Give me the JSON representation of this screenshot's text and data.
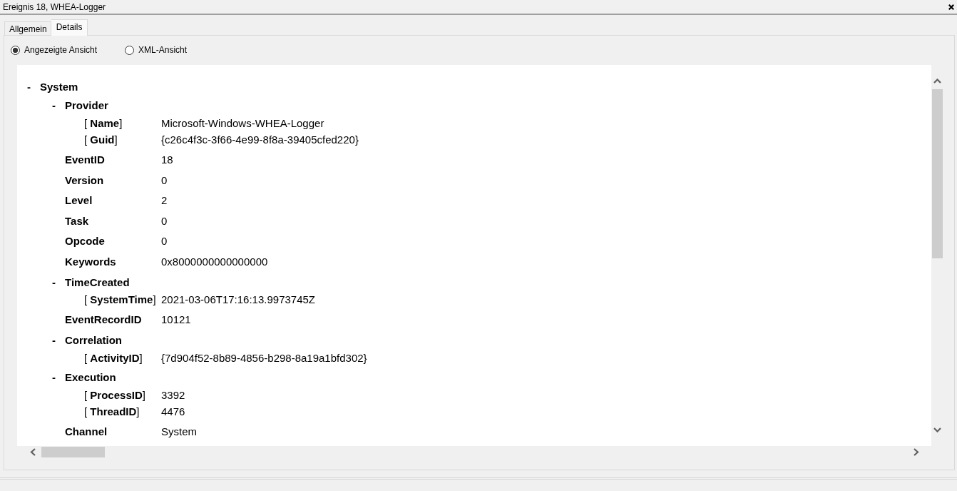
{
  "window": {
    "title": "Ereignis 18, WHEA-Logger"
  },
  "tabs": [
    {
      "label": "Allgemein",
      "selected": false
    },
    {
      "label": "Details",
      "selected": true
    }
  ],
  "view_options": [
    {
      "label": "Angezeigte Ansicht",
      "selected": true
    },
    {
      "label": "XML-Ansicht",
      "selected": false
    }
  ],
  "event_tree": [
    {
      "toggle": "-",
      "name": "System",
      "children": [
        {
          "toggle": "-",
          "name": "Provider",
          "attributes": [
            {
              "label": "[ **Name**]",
              "value": "Microsoft-Windows-WHEA-Logger"
            },
            {
              "label": "[ **Guid**]",
              "value": "{c26c4f3c-3f66-4e99-8f8a-39405cfed220}"
            }
          ]
        },
        {
          "name": "EventID",
          "value": "18"
        },
        {
          "name": "Version",
          "value": "0"
        },
        {
          "name": "Level",
          "value": "2"
        },
        {
          "name": "Task",
          "value": "0"
        },
        {
          "name": "Opcode",
          "value": "0"
        },
        {
          "name": "Keywords",
          "value": "0x8000000000000000"
        },
        {
          "toggle": "-",
          "name": "TimeCreated",
          "attributes": [
            {
              "label": "[ **SystemTime**]",
              "value": "2021-03-06T17:16:13.9973745Z"
            }
          ]
        },
        {
          "name": "EventRecordID",
          "value": "10121"
        },
        {
          "toggle": "-",
          "name": "Correlation",
          "attributes": [
            {
              "label": "[ **ActivityID**]",
              "value": "{7d904f52-8b89-4856-b298-8a19a1bfd302}"
            }
          ]
        },
        {
          "toggle": "-",
          "name": "Execution",
          "attributes": [
            {
              "label": "[ **ProcessID**]",
              "value": "3392"
            },
            {
              "label": "[ **ThreadID**]",
              "value": "4476"
            }
          ]
        },
        {
          "name": "Channel",
          "value": "System"
        }
      ]
    }
  ]
}
